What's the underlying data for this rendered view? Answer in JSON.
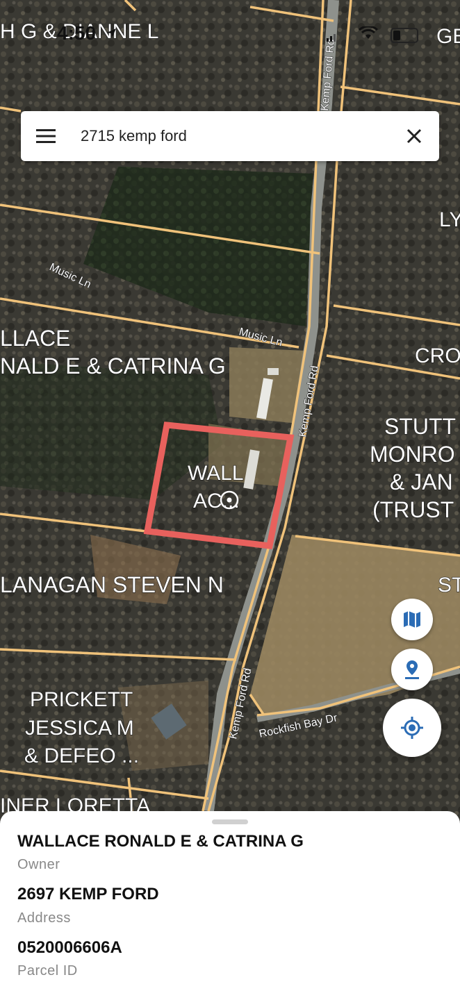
{
  "status_bar": {
    "time": "4:50"
  },
  "search": {
    "query": "2715 kemp ford"
  },
  "map": {
    "parcel_labels": [
      "H G & DIANNE L",
      "GE",
      "LY",
      "LLACE",
      "NALD E & CATRINA G",
      "CRO",
      "STUTT",
      "MONRO",
      "& JAN",
      "(TRUST",
      "WALL",
      "AC...",
      "LANAGAN STEVEN N",
      "ST",
      "PRICKETT",
      "JESSICA M",
      "& DEFEO ...",
      "INER LORETTA"
    ],
    "road_labels": {
      "music_ln_1": "Music Ln",
      "music_ln_2": "Music Ln",
      "kemp_ford_top": "Kemp Ford Rd",
      "kemp_ford_mid": "Kemp Ford Rd",
      "kemp_ford_bottom": "Kemp Ford Rd",
      "rockfish": "Rockfish Bay Dr"
    },
    "selection_color": "#e8615d",
    "parcel_line_color": "#f0c27a"
  },
  "details": {
    "owner_value": "WALLACE RONALD E & CATRINA G",
    "owner_label": "Owner",
    "address_value": "2697 KEMP FORD",
    "address_label": "Address",
    "parcel_value": "0520006606A",
    "parcel_label": "Parcel ID"
  },
  "icons": {
    "menu": "menu-icon",
    "clear": "close-icon",
    "map_layers": "map-icon",
    "pin": "pin-icon",
    "locate": "my-location-icon",
    "wifi": "wifi-icon",
    "battery": "battery-icon",
    "location_arrow": "location-arrow-icon"
  }
}
